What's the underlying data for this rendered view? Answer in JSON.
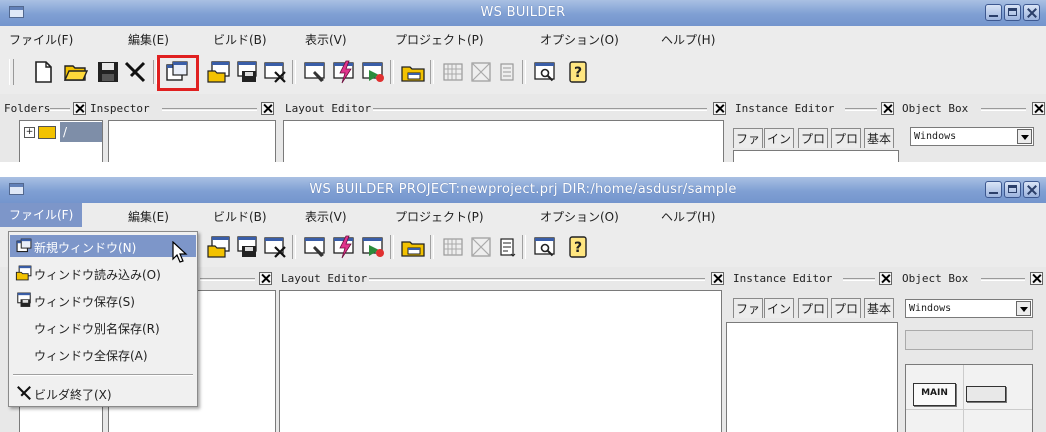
{
  "window1": {
    "title": "WS BUILDER",
    "menus": [
      "ファイル(F)",
      "編集(E)",
      "ビルド(B)",
      "表示(V)",
      "プロジェクト(P)",
      "オプション(O)",
      "ヘルプ(H)"
    ],
    "panes": {
      "folders": "Folders",
      "inspector": "Inspector",
      "layout_editor": "Layout Editor",
      "instance_editor": "Instance Editor",
      "object_box": "Object Box"
    },
    "folder_tree_root": "/",
    "instance_tabs": [
      "ファ",
      "イン",
      "プロ",
      "プロ",
      "基本"
    ],
    "object_box_select": "Windows",
    "highlighted_tool": "new-window"
  },
  "window2": {
    "title": "WS BUILDER PROJECT:newproject.prj DIR:/home/asdusr/sample",
    "menus": [
      "ファイル(F)",
      "編集(E)",
      "ビルド(B)",
      "表示(V)",
      "プロジェクト(P)",
      "オプション(O)",
      "ヘルプ(H)"
    ],
    "active_menu": "ファイル(F)",
    "panes": {
      "layout_editor": "Layout Editor",
      "instance_editor": "Instance Editor",
      "object_box": "Object Box"
    },
    "instance_tabs": [
      "ファ",
      "イン",
      "プロ",
      "プロ",
      "基本"
    ],
    "object_box_select": "Windows",
    "palette_main_label": "MAIN",
    "file_menu": [
      {
        "label": "新規ウィンドウ(N)",
        "icon": "new-window-icon",
        "hover": true
      },
      {
        "label": "ウィンドウ読み込み(O)",
        "icon": "open-window-icon"
      },
      {
        "label": "ウィンドウ保存(S)",
        "icon": "save-window-icon"
      },
      {
        "label": "ウィンドウ別名保存(R)",
        "icon": ""
      },
      {
        "label": "ウィンドウ全保存(A)",
        "icon": ""
      },
      {
        "label": "ビルダ終了(X)",
        "icon": "exit-icon"
      }
    ]
  },
  "colors": {
    "titlebar": "#7f9fd3",
    "menu_highlight": "#7d96c9",
    "highlight_box": "#e02020"
  }
}
